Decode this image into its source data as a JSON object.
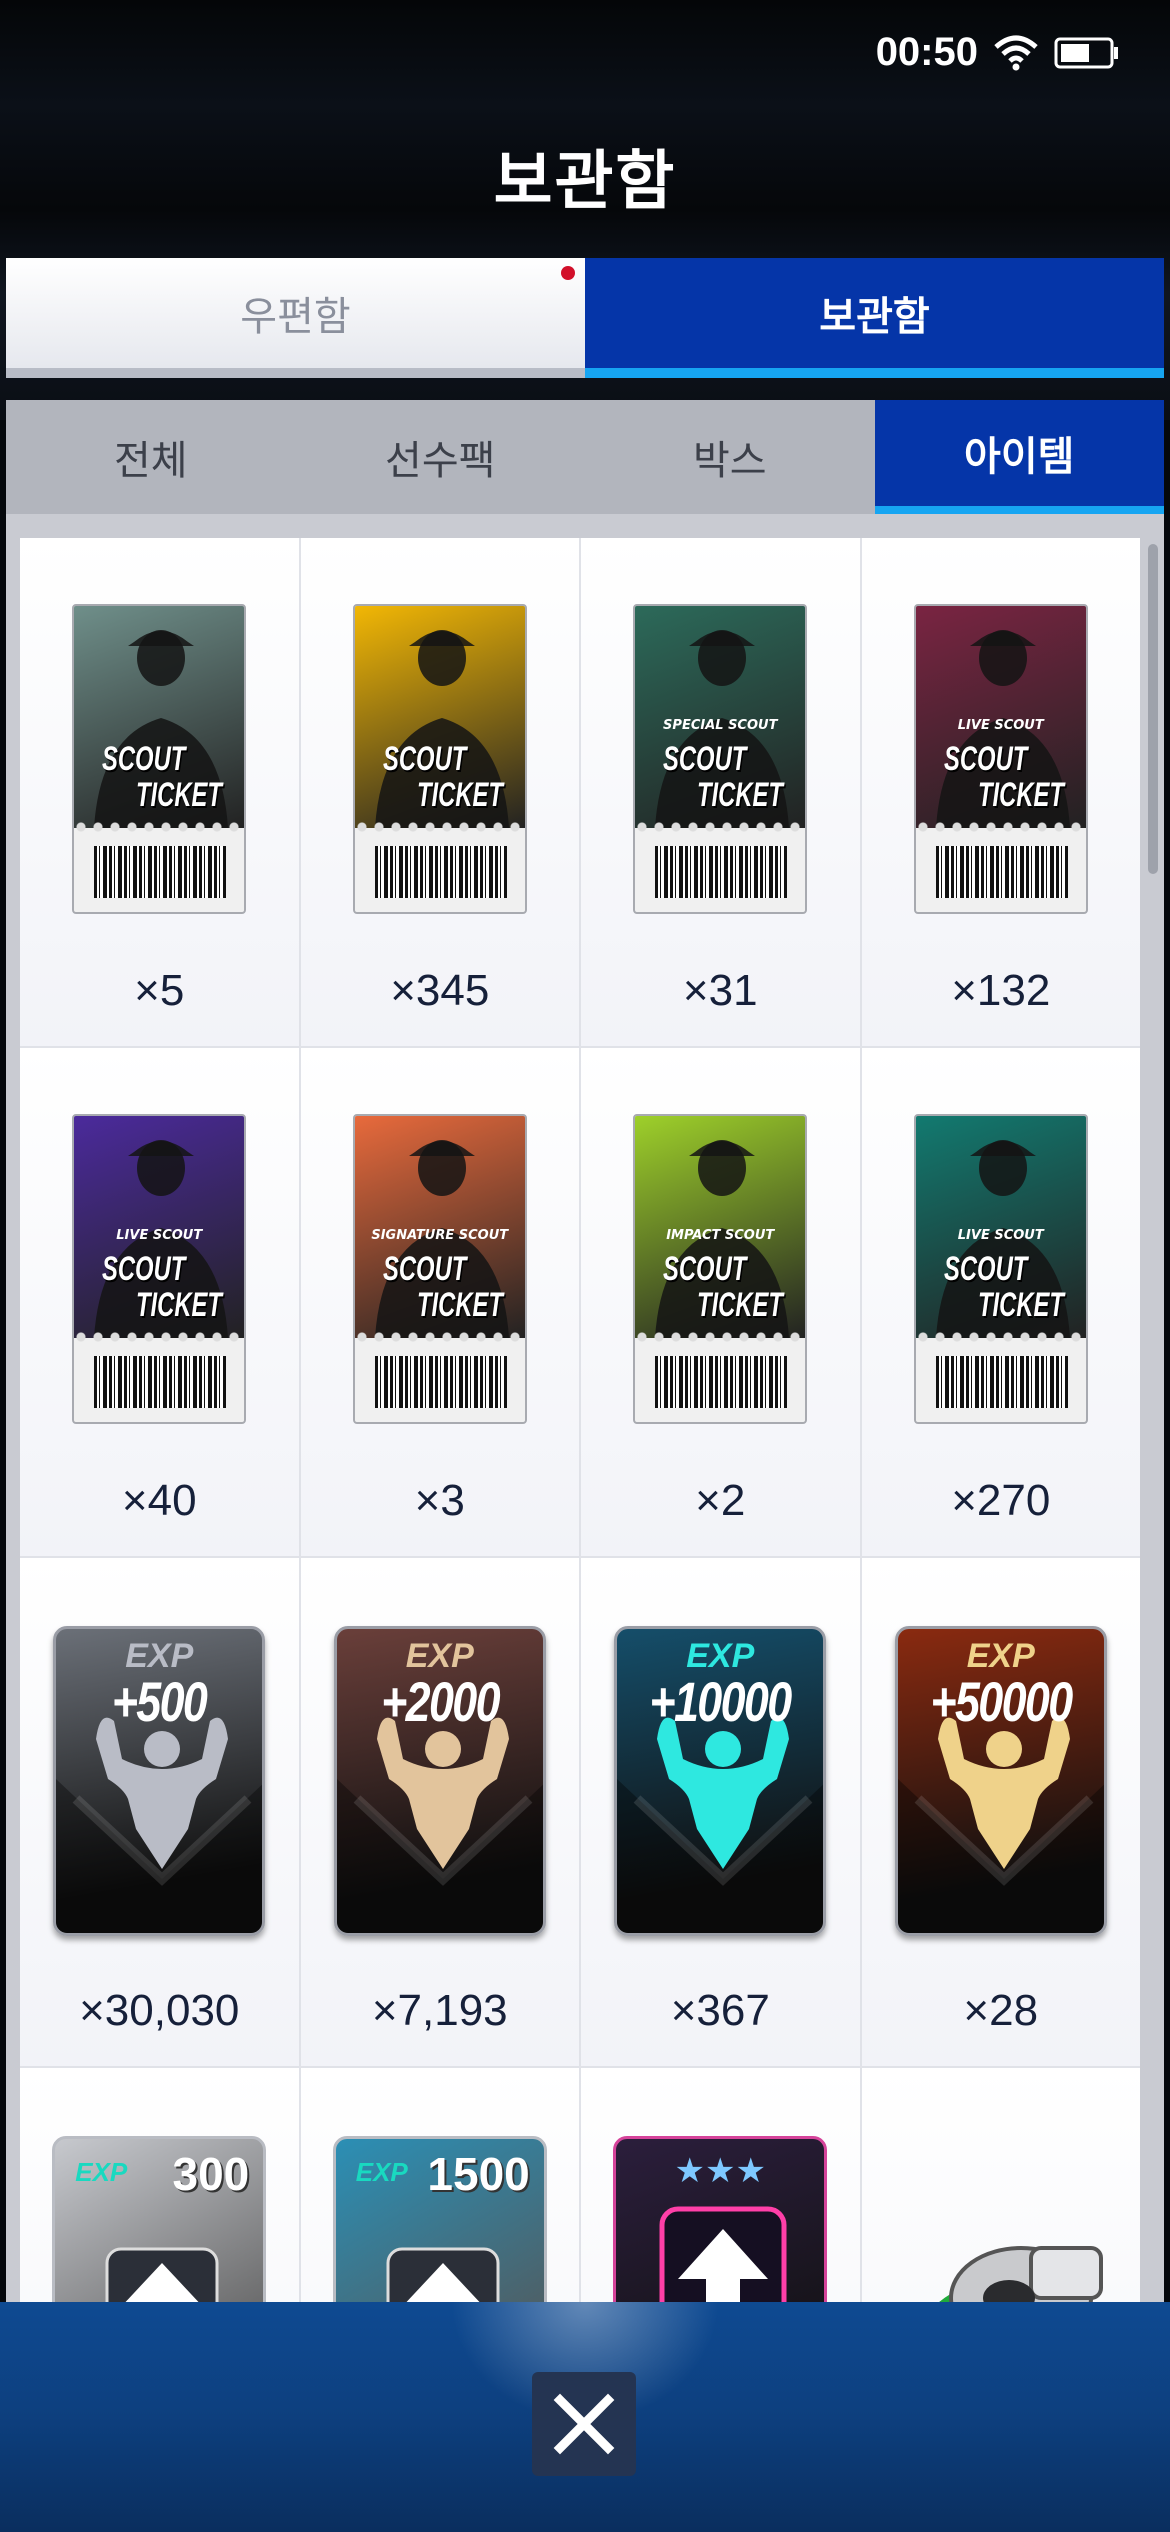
{
  "status_bar": {
    "time": "00:50"
  },
  "header": {
    "title": "보관함"
  },
  "top_tabs": [
    {
      "label": "우편함",
      "active": false,
      "has_notification": true
    },
    {
      "label": "보관함",
      "active": true,
      "has_notification": false
    }
  ],
  "sub_tabs": [
    {
      "label": "전체",
      "active": false
    },
    {
      "label": "선수팩",
      "active": false
    },
    {
      "label": "박스",
      "active": false
    },
    {
      "label": "아이템",
      "active": true
    }
  ],
  "items": [
    {
      "kind": "scout-ticket",
      "sub_label": "",
      "title": [
        "SCOUT",
        "TICKET"
      ],
      "count": "×5",
      "theme": "#6f8f8a"
    },
    {
      "kind": "scout-ticket",
      "sub_label": "",
      "title": [
        "SCOUT",
        "TICKET"
      ],
      "count": "×345",
      "theme": "#f2b705"
    },
    {
      "kind": "scout-ticket",
      "sub_label": "SPECIAL SCOUT",
      "title": [
        "SCOUT",
        "TICKET"
      ],
      "count": "×31",
      "theme": "#2c6a5a"
    },
    {
      "kind": "scout-ticket",
      "sub_label": "LIVE SCOUT",
      "title": [
        "SCOUT",
        "TICKET"
      ],
      "count": "×132",
      "theme": "#7a2442"
    },
    {
      "kind": "scout-ticket",
      "sub_label": "LIVE SCOUT",
      "title": [
        "SCOUT",
        "TICKET"
      ],
      "count": "×40",
      "theme": "#4b2a9c"
    },
    {
      "kind": "scout-ticket",
      "sub_label": "SIGNATURE SCOUT",
      "title": [
        "SCOUT",
        "TICKET"
      ],
      "count": "×3",
      "theme": "#e86a3c"
    },
    {
      "kind": "scout-ticket",
      "sub_label": "IMPACT SCOUT",
      "title": [
        "SCOUT",
        "TICKET"
      ],
      "count": "×2",
      "theme": "#9ed02a"
    },
    {
      "kind": "scout-ticket",
      "sub_label": "LIVE SCOUT",
      "title": [
        "SCOUT",
        "TICKET"
      ],
      "count": "×270",
      "theme": "#127a70"
    },
    {
      "kind": "exp-card",
      "label": "EXP",
      "amount": "+500",
      "count": "×30,030",
      "theme": "#6b7078",
      "figure": "#b9bcc6"
    },
    {
      "kind": "exp-card",
      "label": "EXP",
      "amount": "+2000",
      "count": "×7,193",
      "theme": "#6a3f3a",
      "figure": "#e2c49c"
    },
    {
      "kind": "exp-card",
      "label": "EXP",
      "amount": "+10000",
      "count": "×367",
      "theme": "#154e6a",
      "figure": "#2ee8e0"
    },
    {
      "kind": "exp-card",
      "label": "EXP",
      "amount": "+50000",
      "count": "×28",
      "theme": "#8a2a10",
      "figure": "#efd28a"
    },
    {
      "kind": "exp-mini",
      "label": "EXP",
      "amount": "300",
      "count": "",
      "theme": "#c7c9ce"
    },
    {
      "kind": "exp-mini",
      "label": "EXP",
      "amount": "1500",
      "count": "",
      "theme": "#2b8fb5"
    },
    {
      "kind": "star-mini",
      "stars": "★★★",
      "count": "",
      "theme": "#2b1e3c"
    },
    {
      "kind": "whistle",
      "count": "",
      "theme": "#e8e8ea"
    }
  ]
}
